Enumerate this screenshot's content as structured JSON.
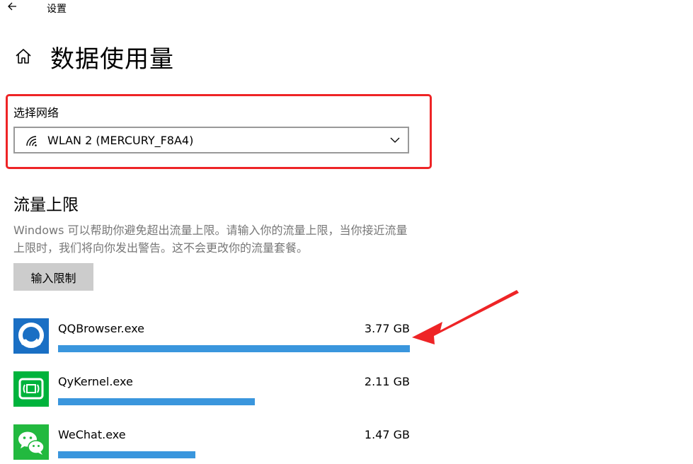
{
  "window": {
    "title": "设置",
    "back_icon": "back-arrow-icon"
  },
  "header": {
    "home_icon": "home-icon",
    "title": "数据使用量"
  },
  "network": {
    "label": "选择网络",
    "selected": "WLAN 2 (MERCURY_F8A4)",
    "icon": "wifi-icon",
    "dropdown_icon": "chevron-down-icon"
  },
  "limit": {
    "title": "流量上限",
    "description": "Windows 可以帮助你避免超出流量上限。请输入你的流量上限，当你接近流量上限时，我们将向你发出警告。这不会更改你的流量套餐。",
    "button_label": "输入限制"
  },
  "apps": [
    {
      "name": "QQBrowser.exe",
      "size": "3.77 GB",
      "usage_fraction": 1.0,
      "icon": "qqbrowser-icon"
    },
    {
      "name": "QyKernel.exe",
      "size": "2.11 GB",
      "usage_fraction": 0.56,
      "icon": "qykernel-icon"
    },
    {
      "name": "WeChat.exe",
      "size": "1.47 GB",
      "usage_fraction": 0.39,
      "icon": "wechat-icon"
    }
  ],
  "colors": {
    "highlight": "#ee2426",
    "bar": "#3a96dd",
    "annotation_arrow": "#ee2426"
  }
}
